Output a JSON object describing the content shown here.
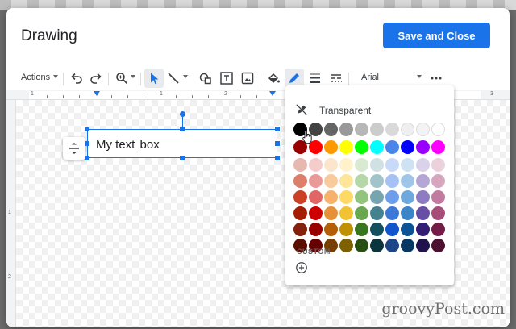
{
  "dialog": {
    "title": "Drawing",
    "primary_button": "Save and Close"
  },
  "toolbar": {
    "actions_label": "Actions",
    "font_name": "Arial",
    "icons": [
      "undo-icon",
      "redo-icon",
      "zoom-icon",
      "select-pointer-icon",
      "line-icon",
      "shape-icon",
      "text-box-icon",
      "image-icon",
      "fill-color-icon",
      "border-color-icon",
      "border-weight-icon",
      "border-dash-icon",
      "more-icon"
    ]
  },
  "ruler": {
    "h_numbers": [
      "1",
      "1",
      "2",
      "3"
    ],
    "v_numbers": [
      "1",
      "2"
    ]
  },
  "canvas": {
    "textbox_text_before_cursor": "My text ",
    "textbox_text_after_cursor": "box"
  },
  "palette": {
    "transparent_label": "Transparent",
    "custom_label": "CUSTOM",
    "colors": [
      [
        "#000000",
        "#434343",
        "#666666",
        "#999999",
        "#b7b7b7",
        "#cccccc",
        "#d9d9d9",
        "#efefef",
        "#f3f3f3",
        "#ffffff"
      ],
      [
        "#980000",
        "#ff0000",
        "#ff9900",
        "#ffff00",
        "#00ff00",
        "#00ffff",
        "#4a86e8",
        "#0000ff",
        "#9900ff",
        "#ff00ff"
      ],
      [
        "#e6b8af",
        "#f4cccc",
        "#fce5cd",
        "#fff2cc",
        "#d9ead3",
        "#d0e0e3",
        "#c9daf8",
        "#cfe2f3",
        "#d9d2e9",
        "#ead1dc"
      ],
      [
        "#dd7e6b",
        "#ea9999",
        "#f9cb9c",
        "#ffe599",
        "#b6d7a8",
        "#a2c4c9",
        "#a4c2f4",
        "#9fc5e8",
        "#b4a7d6",
        "#d5a6bd"
      ],
      [
        "#cc4125",
        "#e06666",
        "#f6b26b",
        "#ffd966",
        "#93c47d",
        "#76a5af",
        "#6d9eeb",
        "#6fa8dc",
        "#8e7cc3",
        "#c27ba0"
      ],
      [
        "#a61c00",
        "#cc0000",
        "#e69138",
        "#f1c232",
        "#6aa84f",
        "#45818e",
        "#3c78d8",
        "#3d85c6",
        "#674ea7",
        "#a64d79"
      ],
      [
        "#85200c",
        "#990000",
        "#b45f06",
        "#bf9000",
        "#38761d",
        "#134f5c",
        "#1155cc",
        "#0b5394",
        "#351c75",
        "#741b47"
      ],
      [
        "#5b0f00",
        "#660000",
        "#783f04",
        "#7f6000",
        "#274e13",
        "#0c343d",
        "#1c4587",
        "#073763",
        "#20124d",
        "#4c1130"
      ]
    ]
  },
  "watermark": "groovyPost.com",
  "colors": {
    "accent": "#1a73e8",
    "text": "#202124"
  }
}
